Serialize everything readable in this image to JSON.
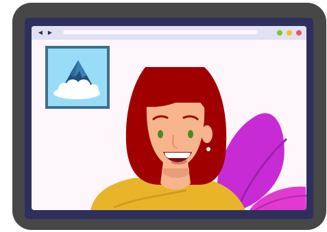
{
  "colors": {
    "device_frame": "#474747",
    "screen_bezel": "#2e2f5a",
    "browser_bg": "#fdf6fb",
    "toolbar_bg": "#e1e1f4",
    "window_dot_green": "#7ec62a",
    "window_dot_yellow": "#f6c21c",
    "window_dot_red": "#f15656",
    "hair": "#a10000",
    "skin": "#f7b58d",
    "shirt": "#e8b52a",
    "plant": "#c62bd4",
    "picture_sky": "#98dcf7",
    "picture_frame": "#3f6e8d"
  },
  "icons": {
    "back": "triangle-left-icon",
    "forward": "triangle-right-icon"
  }
}
